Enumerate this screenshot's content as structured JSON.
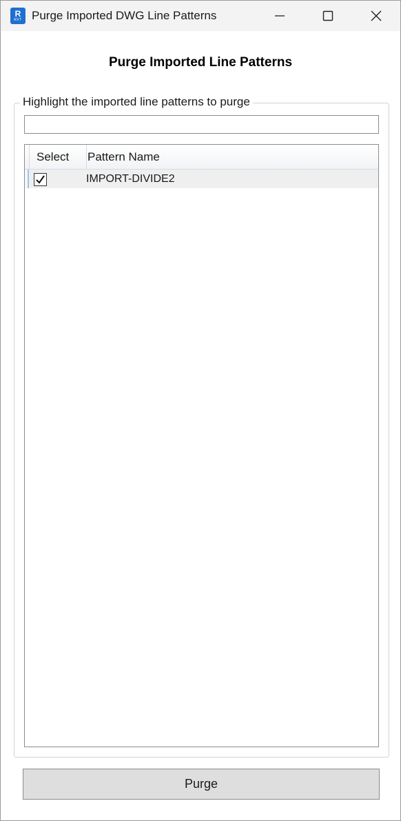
{
  "window": {
    "title": "Purge Imported DWG Line Patterns",
    "app_icon": {
      "letter": "R",
      "sub": "RVT",
      "color": "#1f6fd1"
    }
  },
  "heading": "Purge Imported Line Patterns",
  "group": {
    "label": "Highlight the imported line patterns to purge",
    "filter_value": ""
  },
  "grid": {
    "columns": [
      "Select",
      "Pattern Name"
    ],
    "rows": [
      {
        "selected": true,
        "pattern_name": "IMPORT-DIVIDE2"
      }
    ]
  },
  "purge_label": "Purge"
}
